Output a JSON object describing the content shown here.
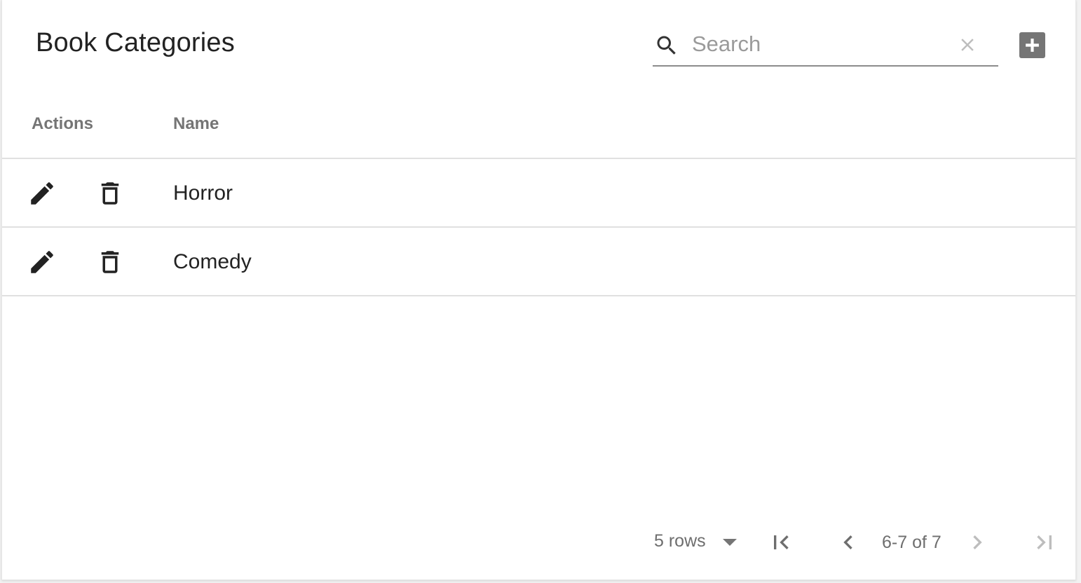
{
  "page": {
    "title": "Book Categories"
  },
  "search": {
    "placeholder": "Search",
    "value": ""
  },
  "toolbar": {
    "add_icon": "add-box-icon",
    "search_icon": "search-icon",
    "clear_icon": "close-icon"
  },
  "table": {
    "columns": [
      "Actions",
      "Name"
    ],
    "rows": [
      {
        "name": "Horror",
        "actions": [
          "edit-icon",
          "delete-icon"
        ]
      },
      {
        "name": "Comedy",
        "actions": [
          "edit-icon",
          "delete-icon"
        ]
      }
    ]
  },
  "pagination": {
    "rows_per_page_label": "5 rows",
    "range_label": "6-7 of 7",
    "buttons": [
      "first-page-icon",
      "prev-page-icon",
      "next-page-icon",
      "last-page-icon"
    ]
  },
  "colors": {
    "text_primary": "#222222",
    "text_secondary": "#757575",
    "divider": "#e0e0e0",
    "add_button_bg": "#757575",
    "disabled_icon": "#bdbdbd"
  }
}
